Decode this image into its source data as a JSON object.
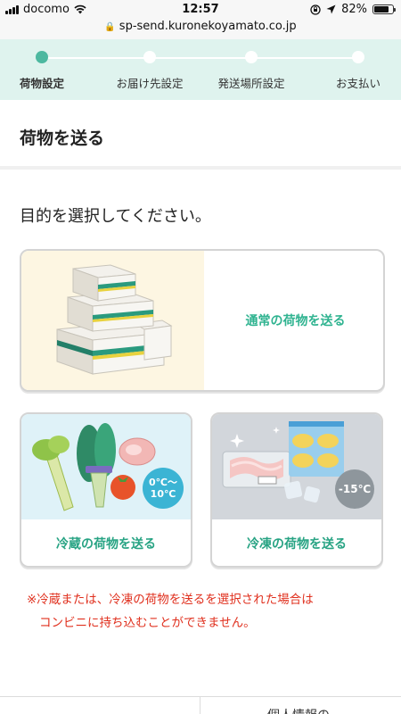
{
  "status_bar": {
    "carrier": "docomo",
    "time": "12:57",
    "battery": "82%",
    "battery_level": 0.82,
    "icons": [
      "signal-icon",
      "wifi-icon",
      "orientation-lock-icon",
      "location-icon",
      "battery-icon"
    ]
  },
  "url_bar": {
    "url": "sp-send.kuronekoyamato.co.jp"
  },
  "progress": {
    "steps": [
      {
        "label": "荷物設定",
        "active": true
      },
      {
        "label": "お届け先設定",
        "active": false
      },
      {
        "label": "発送場所設定",
        "active": false
      },
      {
        "label": "お支払い",
        "active": false
      }
    ]
  },
  "header": {
    "title": "荷物を送る"
  },
  "main": {
    "prompt": "目的を選択してください。",
    "options": {
      "normal": {
        "label": "通常の荷物を送る"
      },
      "chilled": {
        "label": "冷蔵の荷物を送る",
        "temp_line1": "0℃〜",
        "temp_line2": "10℃"
      },
      "frozen": {
        "label": "冷凍の荷物を送る",
        "temp": "-15℃"
      }
    },
    "notice": {
      "line1": "※冷蔵または、冷凍の荷物を送るを選択された場合は",
      "line2": "コンビニに持ち込むことができません。"
    }
  },
  "footer": {
    "link": "個人情報の"
  },
  "colors": {
    "accent": "#4db8a0",
    "progress_bg": "#dff3ee",
    "label_green": "#2fb390",
    "notice_red": "#e0301e",
    "chilled_badge": "#3bb4d4",
    "frozen_badge": "#8e969c"
  }
}
